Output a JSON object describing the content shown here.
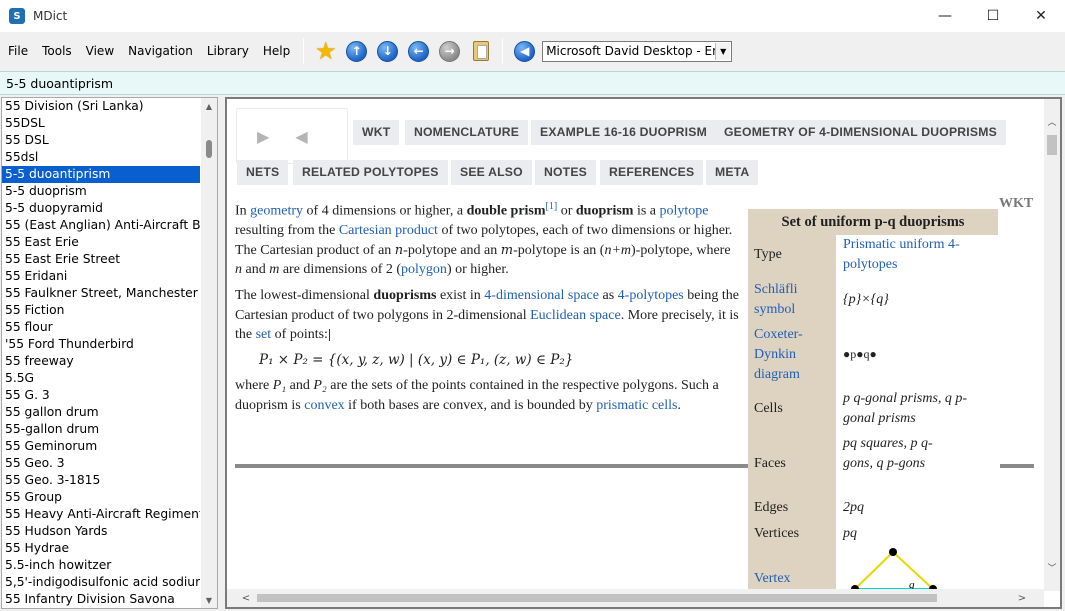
{
  "window": {
    "title": "MDict",
    "minimize": "—",
    "maximize": "☐",
    "close": "✕"
  },
  "menu": [
    "File",
    "Tools",
    "View",
    "Navigation",
    "Library",
    "Help"
  ],
  "toolbar": {
    "voice": "Microsoft David Desktop - Engli"
  },
  "search": {
    "value": "5-5 duoantiprism"
  },
  "wordlist": {
    "items": [
      "55 Division (Sri Lanka)",
      "55DSL",
      "55 DSL",
      "55dsl",
      "5-5 duoantiprism",
      "5-5 duoprism",
      "5-5 duopyramid",
      "55 (East Anglian) Anti-Aircraft Brigade",
      "55 East Erie",
      "55 East Erie Street",
      "55 Eridani",
      "55 Faulkner Street, Manchester",
      "55 Fiction",
      "55 flour",
      "'55 Ford Thunderbird",
      "55 freeway",
      "5.5G",
      "55 G. 3",
      "55 gallon drum",
      "55-gallon drum",
      "55 Geminorum",
      "55 Geo. 3",
      "55 Geo. 3-1815",
      "55 Group",
      "55 Heavy Anti-Aircraft Regiment RA",
      "55 Hudson Yards",
      "55 Hydrae",
      "5.5-inch howitzer",
      "5,5'-indigodisulfonic acid sodium",
      "55 Infantry Division Savona"
    ],
    "selected_index": 4
  },
  "nav": {
    "forward": "▶",
    "back": "◀"
  },
  "tabs_row1": [
    "WKT",
    "NOMENCLATURE",
    "EXAMPLE 16-16 DUOPRISM",
    "GEOMETRY OF 4-DIMENSIONAL DUOPRISMS"
  ],
  "tabs_row2": [
    "NETS",
    "RELATED POLYTOPES",
    "SEE ALSO",
    "NOTES",
    "REFERENCES",
    "META"
  ],
  "article": {
    "p1": {
      "a": "In ",
      "b": "geometry",
      "c": " of 4 dimensions or higher, a ",
      "d": "double prism",
      "e": "[1]",
      "f": " or ",
      "g": "duoprism",
      "h": " is a ",
      "i": "polytope",
      "j": " resulting from the ",
      "k": "Cartesian product",
      "l": " of two polytopes, each of two dimensions or higher. The Cartesian product of an ",
      "m": "n",
      "n": "-polytope and an ",
      "o": "m",
      "p": "-polytope is an (",
      "q": "n+m",
      "r": ")-polytope, where ",
      "s": "n",
      "t": " and ",
      "u": "m",
      "v": " are dimensions of 2 (",
      "w": "polygon",
      "x": ") or higher."
    },
    "p2": {
      "a": "The lowest-dimensional ",
      "b": "duoprisms",
      "c": " exist in ",
      "d": "4-dimensional space",
      "e": " as ",
      "f": "4-polytopes",
      "g": " being the Cartesian product of two polygons in 2-dimensional ",
      "h": "Euclidean space",
      "i": ". More precisely, it is the ",
      "j": "set",
      "k": " of points:"
    },
    "formula": "P₁ × P₂ = {(x, y, z, w) | (x, y) ∈ P₁, (z, w) ∈ P₂}",
    "p3": {
      "a": "where ",
      "b": "P₁",
      "c": " and ",
      "d": "P₂",
      "e": " are the sets of the points contained in the respective polygons. Such a duoprism is ",
      "f": "convex",
      "g": " if both bases are convex, and is bounded by ",
      "h": "prismatic cells",
      "i": "."
    }
  },
  "wkt_side": "WKT",
  "infobox": {
    "title": "Set of uniform p-q duoprisms",
    "rows": [
      {
        "label": "Type",
        "value": "Prismatic uniform 4-polytopes"
      },
      {
        "label": "Schläfli symbol",
        "value": "{p}×{q}"
      },
      {
        "label": "Coxeter-Dynkin diagram",
        "value": "●p●q●"
      },
      {
        "label": "Cells",
        "value": "p q-gonal prisms, q p-gonal prisms"
      },
      {
        "label": "Faces",
        "value": "pq squares, p q-gons, q p-gons"
      },
      {
        "label": "Edges",
        "value": "2pq"
      },
      {
        "label": "Vertices",
        "value": "pq"
      },
      {
        "label": "Vertex",
        "value": ""
      }
    ],
    "vertex_fig_label": "q"
  }
}
